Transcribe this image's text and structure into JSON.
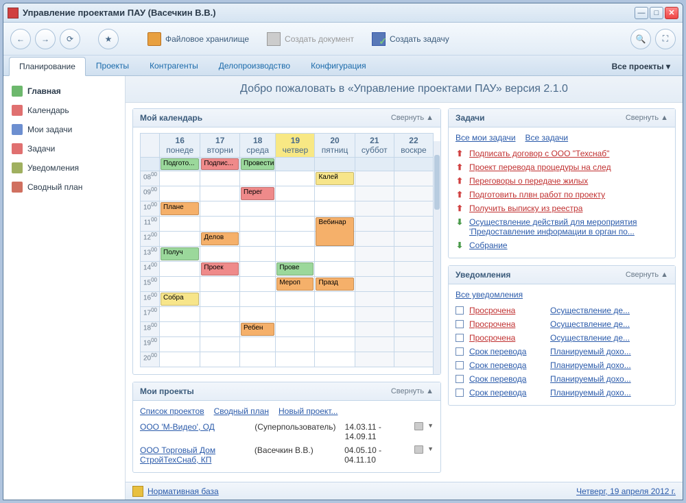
{
  "window_title": "Управление проектами ПАУ (Васечкин В.В.)",
  "toolbar": {
    "file_storage": "Файловое хранилище",
    "create_doc": "Создать документ",
    "create_task": "Создать задачу"
  },
  "tabs": [
    "Планирование",
    "Проекты",
    "Контрагенты",
    "Делопроизводство",
    "Конфигурация"
  ],
  "all_projects": "Все проекты ▾",
  "sidebar": [
    {
      "icon": "home",
      "label": "Главная",
      "active": true
    },
    {
      "icon": "cal",
      "label": "Календарь"
    },
    {
      "icon": "mytask",
      "label": "Мои задачи"
    },
    {
      "icon": "tasks",
      "label": "Задачи"
    },
    {
      "icon": "notif",
      "label": "Уведомления"
    },
    {
      "icon": "plan",
      "label": "Сводный план"
    }
  ],
  "welcome": "Добро пожаловать в «Управление проектами ПАУ» версия 2.1.0",
  "collapse": "Свернуть ▲",
  "calendar": {
    "title": "Мой календарь",
    "days": [
      {
        "n": "16",
        "w": "понеде",
        "today": false
      },
      {
        "n": "17",
        "w": "вторни",
        "today": false
      },
      {
        "n": "18",
        "w": "среда",
        "today": false
      },
      {
        "n": "19",
        "w": "четвер",
        "today": true
      },
      {
        "n": "20",
        "w": "пятниц",
        "today": false
      },
      {
        "n": "21",
        "w": "суббот",
        "today": false,
        "we": true
      },
      {
        "n": "22",
        "w": "воскре",
        "today": false,
        "we": true
      }
    ],
    "all_day": [
      {
        "day": 0,
        "color": "green",
        "t": "Подгото..."
      },
      {
        "day": 1,
        "color": "red",
        "t": "Подпис..."
      },
      {
        "day": 2,
        "color": "green",
        "t": "Провести"
      }
    ],
    "hours": [
      "08",
      "09",
      "10",
      "11",
      "12",
      "13",
      "14",
      "15",
      "16",
      "17",
      "18",
      "19",
      "20"
    ],
    "events": [
      {
        "h": "08",
        "day": 4,
        "color": "yellow",
        "t": "Калей"
      },
      {
        "h": "09",
        "day": 2,
        "color": "red",
        "t": "Перег"
      },
      {
        "h": "10",
        "day": 0,
        "color": "orange",
        "t": "Плане"
      },
      {
        "h": "11",
        "day": 4,
        "color": "orange",
        "t": "Вебинар",
        "span": 2
      },
      {
        "h": "12",
        "day": 1,
        "color": "orange",
        "t": "Делов"
      },
      {
        "h": "13",
        "day": 0,
        "color": "green",
        "t": "Получ"
      },
      {
        "h": "14",
        "day": 1,
        "color": "red",
        "t": "Проек"
      },
      {
        "h": "14",
        "day": 3,
        "color": "green",
        "t": "Прове"
      },
      {
        "h": "15",
        "day": 3,
        "color": "orange",
        "t": "Мероп"
      },
      {
        "h": "15",
        "day": 4,
        "color": "orange",
        "t": "Празд"
      },
      {
        "h": "16",
        "day": 0,
        "color": "yellow",
        "t": "Собра"
      },
      {
        "h": "18",
        "day": 2,
        "color": "orange",
        "t": "Ребен"
      }
    ]
  },
  "projects": {
    "title": "Мои проекты",
    "links": [
      "Список проектов",
      "Сводный план",
      "Новый проект..."
    ],
    "rows": [
      {
        "name": "ООО 'М-Видео', ОД",
        "user": "(Суперпользователь)",
        "dates": "14.03.11 - 14.09.11"
      },
      {
        "name": "ООО Торговый Дом СтройТехСнаб, КП",
        "user": "(Васечкин В.В.)",
        "dates": "04.05.10 - 04.11.10"
      }
    ]
  },
  "tasks": {
    "title": "Задачи",
    "links": [
      "Все мои задачи",
      "Все задачи"
    ],
    "items": [
      {
        "dir": "up",
        "t": "Подписать договор с ООО \"Техснаб\""
      },
      {
        "dir": "up",
        "t": "Проект перевода процедуры на след"
      },
      {
        "dir": "up",
        "t": "Переговоры о передаче жилых"
      },
      {
        "dir": "up",
        "t": "Подготовить плвн работ по проекту"
      },
      {
        "dir": "up",
        "t": "Получить выписку из реестра"
      },
      {
        "dir": "down",
        "t": "Осуществление действий для мероприятия 'Предоставление информации в орган по..."
      },
      {
        "dir": "down",
        "t": "Собрание"
      }
    ]
  },
  "notifications": {
    "title": "Уведомления",
    "link": "Все уведомления",
    "rows": [
      {
        "status": "Просрочена",
        "red": true,
        "subj": "Осуществление де..."
      },
      {
        "status": "Просрочена",
        "red": true,
        "subj": "Осуществление де..."
      },
      {
        "status": "Просрочена",
        "red": true,
        "subj": "Осуществление де..."
      },
      {
        "status": "Срок перевода",
        "red": false,
        "subj": "Планируемый дохо..."
      },
      {
        "status": "Срок перевода",
        "red": false,
        "subj": "Планируемый дохо..."
      },
      {
        "status": "Срок перевода",
        "red": false,
        "subj": "Планируемый дохо..."
      },
      {
        "status": "Срок перевода",
        "red": false,
        "subj": "Планируемый дохо..."
      }
    ]
  },
  "footer": {
    "norm": "Нормативная база",
    "date": "Четверг, 19 апреля 2012 г."
  }
}
